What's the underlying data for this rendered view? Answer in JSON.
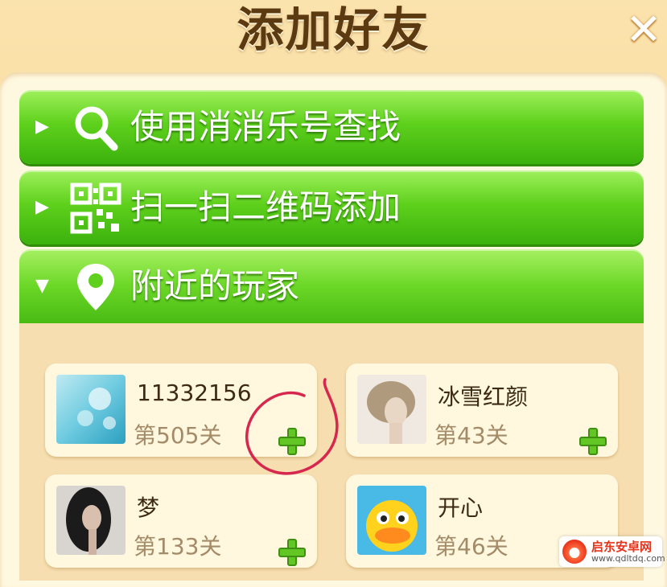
{
  "header": {
    "title": "添加好友",
    "close_icon": "close-x-icon"
  },
  "options": [
    {
      "label": "使用消消乐号查找",
      "icon": "search-icon",
      "arrow": "▶",
      "expanded": false
    },
    {
      "label": "扫一扫二维码添加",
      "icon": "qr-code-icon",
      "arrow": "▶",
      "expanded": false
    },
    {
      "label": "附近的玩家",
      "icon": "location-pin-icon",
      "arrow": "▼",
      "expanded": true
    }
  ],
  "players": [
    {
      "name": "11332156",
      "level": "第505关"
    },
    {
      "name": "冰雪红颜",
      "level": "第43关"
    },
    {
      "name": "梦",
      "level": "第133关"
    },
    {
      "name": "开心",
      "level": "第46关"
    }
  ],
  "watermark": {
    "title": "启东安卓网",
    "url": "www.qdltdq.com"
  },
  "colors": {
    "option_green": "#5fd11d",
    "add_green": "#62c624",
    "annotation_red": "#d6284f"
  }
}
